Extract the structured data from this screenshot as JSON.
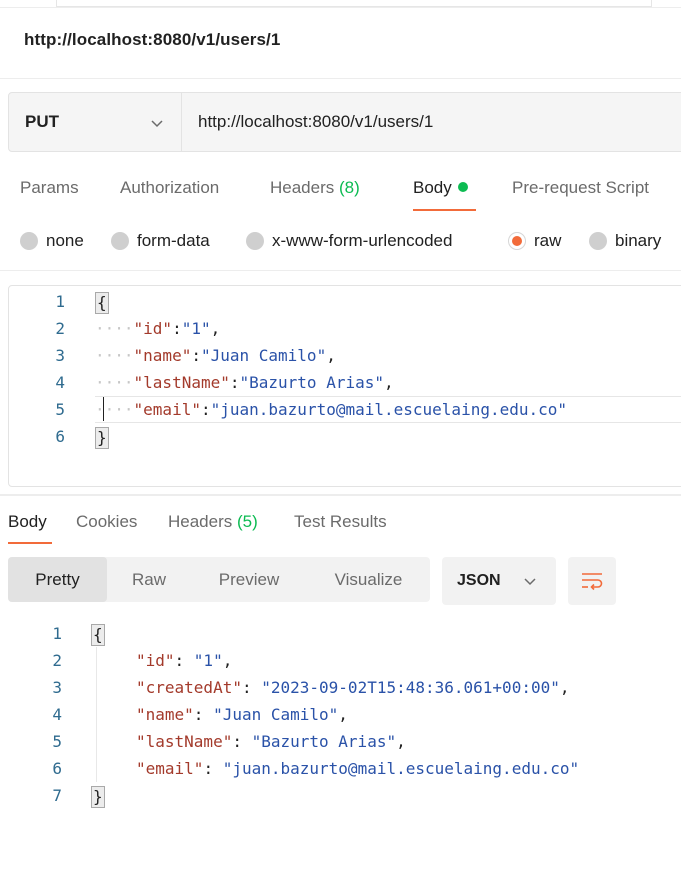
{
  "request": {
    "title": "http://localhost:8080/v1/users/1",
    "method": "PUT",
    "url": "http://localhost:8080/v1/users/1"
  },
  "request_tabs": [
    {
      "label": "Params"
    },
    {
      "label": "Authorization"
    },
    {
      "label": "Headers",
      "count": "(8)"
    },
    {
      "label": "Body"
    },
    {
      "label": "Pre-request Script"
    }
  ],
  "body_types": [
    {
      "label": "none",
      "selected": false
    },
    {
      "label": "form-data",
      "selected": false
    },
    {
      "label": "x-www-form-urlencoded",
      "selected": false
    },
    {
      "label": "raw",
      "selected": true
    },
    {
      "label": "binary",
      "selected": false
    }
  ],
  "request_body": {
    "line_numbers": [
      "1",
      "2",
      "3",
      "4",
      "5",
      "6"
    ],
    "open": "{",
    "close": "}",
    "fields": [
      {
        "key": "\"id\"",
        "value": "\"1\"",
        "comma": ","
      },
      {
        "key": "\"name\"",
        "value": "\"Juan Camilo\"",
        "comma": ","
      },
      {
        "key": "\"lastName\"",
        "value": "\"Bazurto Arias\"",
        "comma": ","
      },
      {
        "key": "\"email\"",
        "value": "\"juan.bazurto@mail.escuelaing.edu.co\"",
        "comma": ""
      }
    ]
  },
  "response_tabs": [
    {
      "label": "Body"
    },
    {
      "label": "Cookies"
    },
    {
      "label": "Headers",
      "count": "(5)"
    },
    {
      "label": "Test Results"
    }
  ],
  "view_modes": [
    "Pretty",
    "Raw",
    "Preview",
    "Visualize"
  ],
  "active_view": "Pretty",
  "format": "JSON",
  "response_body": {
    "line_numbers": [
      "1",
      "2",
      "3",
      "4",
      "5",
      "6",
      "7"
    ],
    "open": "{",
    "close": "}",
    "fields": [
      {
        "key": "\"id\"",
        "value": "\"1\"",
        "comma": ","
      },
      {
        "key": "\"createdAt\"",
        "value": "\"2023-09-02T15:48:36.061+00:00\"",
        "comma": ","
      },
      {
        "key": "\"name\"",
        "value": "\"Juan Camilo\"",
        "comma": ","
      },
      {
        "key": "\"lastName\"",
        "value": "\"Bazurto Arias\"",
        "comma": ","
      },
      {
        "key": "\"email\"",
        "value": "\"juan.bazurto@mail.escuelaing.edu.co\"",
        "comma": ""
      }
    ]
  },
  "colors": {
    "accent": "#f26b3a",
    "count_green": "#0cbb52",
    "json_key": "#a33a2b",
    "json_string": "#2a52a8"
  },
  "icons": [
    "chevron-down-icon",
    "status-dot-icon",
    "wrap-lines-icon"
  ]
}
